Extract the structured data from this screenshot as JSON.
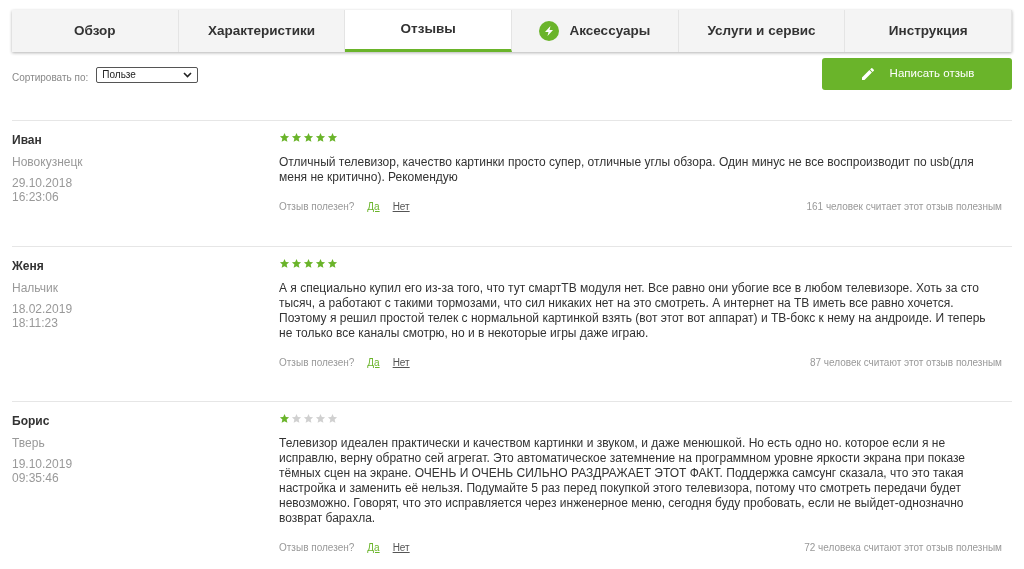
{
  "tabs": [
    {
      "label": "Обзор",
      "selected": false
    },
    {
      "label": "Характеристики",
      "selected": false
    },
    {
      "label": "Отзывы",
      "selected": true
    },
    {
      "label": "Аксессуары",
      "selected": false,
      "kind": "icon"
    },
    {
      "label": "Услуги и сервис",
      "selected": false
    },
    {
      "label": "Инструкция",
      "selected": false
    }
  ],
  "sort": {
    "label": "Сортировать по:",
    "value": "Пользе"
  },
  "write_button": "Написать отзыв",
  "reviews": [
    {
      "author": "Иван",
      "city": "Новокузнецк",
      "date": "29.10.2018",
      "time": "16:23:06",
      "stars": 5,
      "text": "Отличный телевизор, качество картинки просто супер, отличные углы обзора. Один минус не все воспроизводит по usb(для меня не критично). Рекомендую",
      "helpful_label": "Отзыв полезен?",
      "yes": "Да",
      "no": "Нет",
      "count": "161 человек считает этот отзыв полезным"
    },
    {
      "author": "Женя",
      "city": "Нальчик",
      "date": "18.02.2019",
      "time": "18:11:23",
      "stars": 5,
      "text": "А я специально купил его из-за того, что тут смартТВ модуля нет. Все равно они убогие все в любом телевизоре. Хоть за сто тысяч, а работают с такими тормозами, что сил никаких нет на это смотреть. А интернет на ТВ иметь все равно хочется. Поэтому я решил простой телек с нормальной картинкой взять (вот этот вот аппарат) и ТВ-бокс к нему на андроиде. И теперь не только все каналы смотрю, но и в некоторые игры даже играю.",
      "helpful_label": "Отзыв полезен?",
      "yes": "Да",
      "no": "Нет",
      "count": "87 человек считают этот отзыв полезным"
    },
    {
      "author": "Борис",
      "city": "Тверь",
      "date": "19.10.2019",
      "time": "09:35:46",
      "stars": 1,
      "text": "Телевизор идеален практически и качеством картинки и звуком, и даже менюшкой. Но есть одно но. которое если я не исправлю, верну обратно сей агрегат. Это автоматическое затемнение на программном уровне яркости экрана при показе тёмных сцен на экране. ОЧЕНЬ И ОЧЕНЬ СИЛЬНО РАЗДРАЖАЕТ ЭТОТ ФАКТ. Поддержка самсунг сказала, что это такая настройка и заменить её нельзя. Подумайте 5 раз перед покупкой этого телевизора, потому что смотреть передачи будет невозможно. Говорят, что это исправляется через инженерное меню, сегодня буду пробовать, если не выйдет-однозначно возврат барахла.",
      "helpful_label": "Отзыв полезен?",
      "yes": "Да",
      "no": "Нет",
      "count": "72 человека считают этот отзыв полезным"
    }
  ]
}
